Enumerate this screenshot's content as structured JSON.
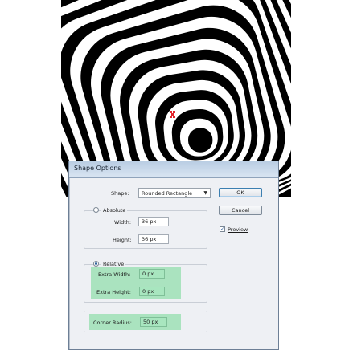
{
  "dialog": {
    "title": "Shape Options",
    "shape_label": "Shape:",
    "shape_value": "Rounded Rectangle",
    "absolute_label": "Absolute",
    "width_label": "Width:",
    "width_value": "36 px",
    "height_label": "Height:",
    "height_value": "36 px",
    "relative_label": "Relative",
    "extra_width_label": "Extra Width:",
    "extra_width_value": "0 px",
    "extra_height_label": "Extra Height:",
    "extra_height_value": "0 px",
    "corner_radius_label": "Corner Radius:",
    "corner_radius_value": "50 px",
    "ok_label": "OK",
    "cancel_label": "Cancel",
    "preview_label": "Preview",
    "preview_checked": true,
    "selected_mode": "Relative"
  },
  "colors": {
    "highlight": "#9ee0b5",
    "art_black": "#000000",
    "art_red_marker": "#e3262e"
  }
}
